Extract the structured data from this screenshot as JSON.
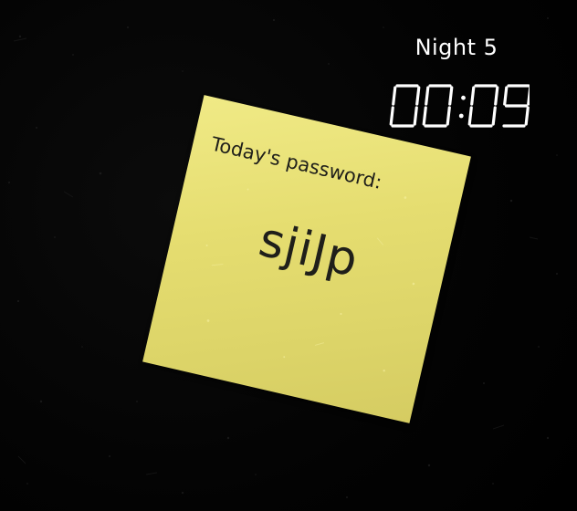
{
  "hud": {
    "night": "Night 5",
    "time": "00:09"
  },
  "note": {
    "heading": "Today's password:",
    "password": "sjiJp"
  },
  "colors": {
    "background": "#020202",
    "hud_text": "#ffffff",
    "note_paper": "#e5dd70",
    "note_ink": "#1f1f1a"
  },
  "icons": {
    "clock": "seven-segment-digital-clock"
  }
}
